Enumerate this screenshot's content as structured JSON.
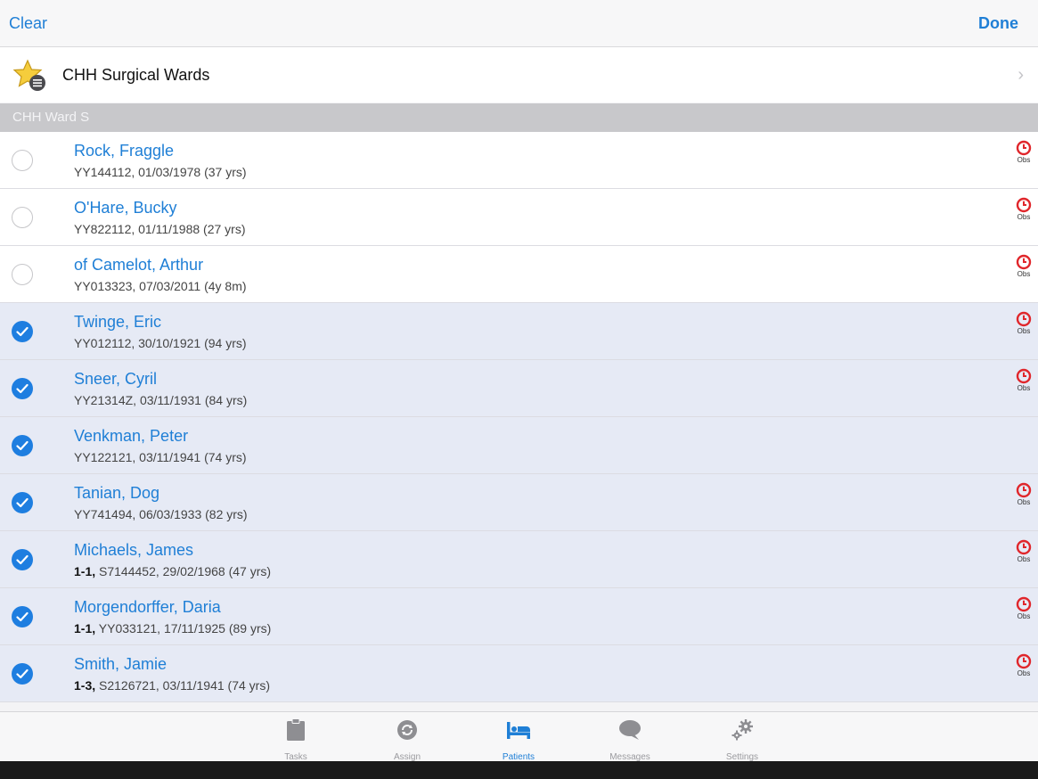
{
  "navbar": {
    "clear_label": "Clear",
    "done_label": "Done"
  },
  "ward": {
    "title": "CHH Surgical Wards",
    "chevron": "›",
    "icon": "star-list-icon"
  },
  "section": {
    "title": "CHH Ward S"
  },
  "patients": [
    {
      "name": "Rock, Fraggle",
      "prefix": "",
      "detail": "YY144112, 01/03/1978 (37 yrs)",
      "selected": false,
      "obs": "Obs"
    },
    {
      "name": "O'Hare, Bucky",
      "prefix": "",
      "detail": "YY822112, 01/11/1988 (27 yrs)",
      "selected": false,
      "obs": "Obs"
    },
    {
      "name": "of Camelot, Arthur",
      "prefix": "",
      "detail": "YY013323, 07/03/2011 (4y 8m)",
      "selected": false,
      "obs": "Obs"
    },
    {
      "name": "Twinge, Eric",
      "prefix": "",
      "detail": "YY012112, 30/10/1921 (94 yrs)",
      "selected": true,
      "obs": "Obs"
    },
    {
      "name": "Sneer, Cyril",
      "prefix": "",
      "detail": "YY21314Z, 03/11/1931 (84 yrs)",
      "selected": true,
      "obs": "Obs"
    },
    {
      "name": "Venkman, Peter",
      "prefix": "",
      "detail": "YY122121, 03/11/1941 (74 yrs)",
      "selected": true,
      "obs": ""
    },
    {
      "name": "Tanian, Dog",
      "prefix": "",
      "detail": "YY741494, 06/03/1933 (82 yrs)",
      "selected": true,
      "obs": "Obs"
    },
    {
      "name": "Michaels, James",
      "prefix": "1-1,",
      "detail": "S7144452, 29/02/1968 (47 yrs)",
      "selected": true,
      "obs": "Obs"
    },
    {
      "name": "Morgendorffer, Daria",
      "prefix": "1-1,",
      "detail": "YY033121, 17/11/1925 (89 yrs)",
      "selected": true,
      "obs": "Obs"
    },
    {
      "name": "Smith, Jamie",
      "prefix": "1-3,",
      "detail": "S2126721, 03/11/1941 (74 yrs)",
      "selected": true,
      "obs": "Obs"
    }
  ],
  "tabs": [
    {
      "label": "Tasks",
      "icon": "clipboard-icon",
      "active": false
    },
    {
      "label": "Assign",
      "icon": "assign-icon",
      "active": false
    },
    {
      "label": "Patients",
      "icon": "bed-icon",
      "active": true
    },
    {
      "label": "Messages",
      "icon": "speech-bubble-icon",
      "active": false
    },
    {
      "label": "Settings",
      "icon": "gears-icon",
      "active": false
    }
  ],
  "colors": {
    "accent": "#1f7fd6",
    "obs_red": "#e0262b",
    "selected_row": "#e6eaf5",
    "section_header": "#c8c8cb"
  }
}
